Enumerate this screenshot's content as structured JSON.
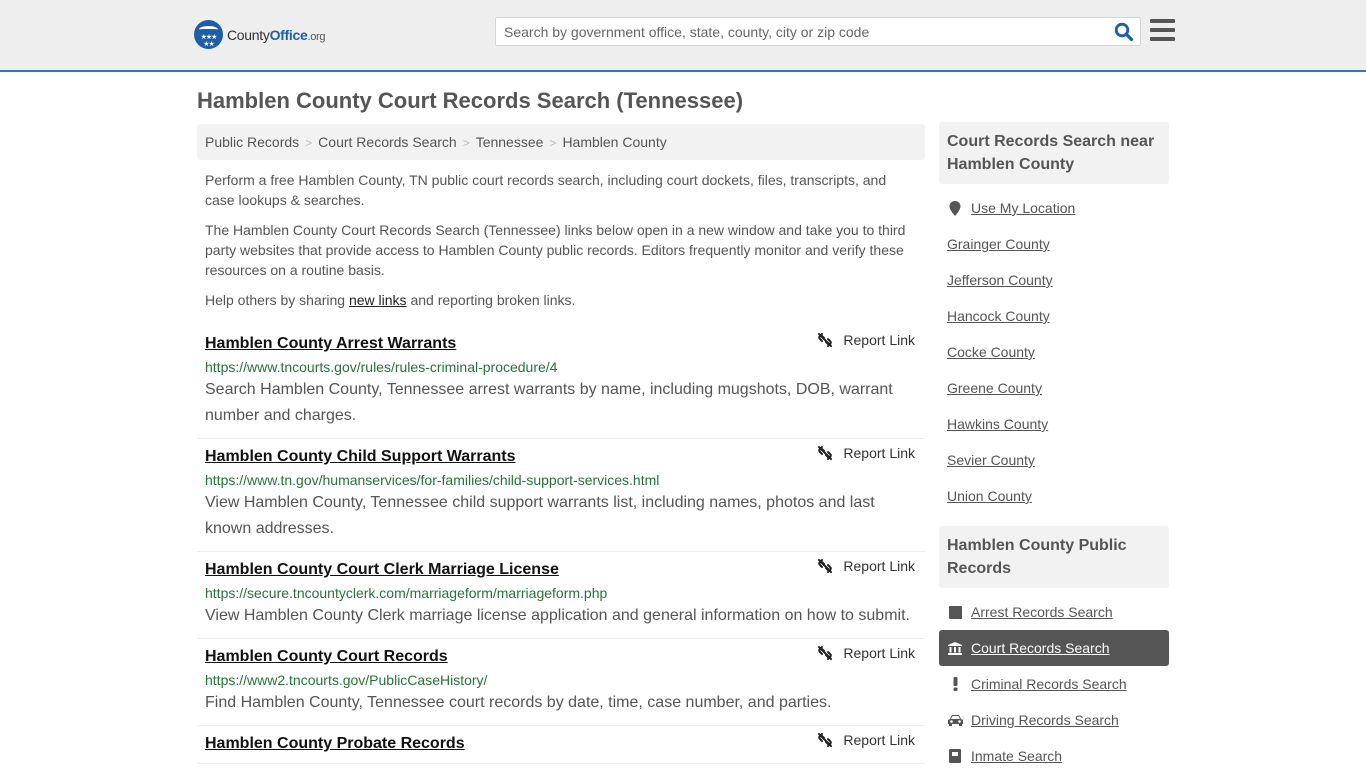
{
  "header": {
    "logo": {
      "county": "County",
      "office": "Office",
      "org": ".org"
    },
    "search_placeholder": "Search by government office, state, county, city or zip code",
    "search_value": "",
    "brand_color": "#1d5ea8",
    "accent_color": "#2f7ab5"
  },
  "page_title": "Hamblen County Court Records Search (Tennessee)",
  "breadcrumb": [
    {
      "label": "Public Records"
    },
    {
      "label": "Court Records Search"
    },
    {
      "label": "Tennessee"
    },
    {
      "label": "Hamblen County"
    }
  ],
  "intro": {
    "p1": "Perform a free Hamblen County, TN public court records search, including court dockets, files, transcripts, and case lookups & searches.",
    "p2": "The Hamblen County Court Records Search (Tennessee) links below open in a new window and take you to third party websites that provide access to Hamblen County public records. Editors frequently monitor and verify these resources on a routine basis.",
    "p3_before": "Help others by sharing ",
    "p3_link": "new links",
    "p3_after": " and reporting broken links."
  },
  "report_label": "Report Link",
  "results": [
    {
      "title": "Hamblen County Arrest Warrants",
      "url": "https://www.tncourts.gov/rules/rules-criminal-procedure/4",
      "desc": "Search Hamblen County, Tennessee arrest warrants by name, including mugshots, DOB, warrant number and charges."
    },
    {
      "title": "Hamblen County Child Support Warrants",
      "url": "https://www.tn.gov/humanservices/for-families/child-support-services.html",
      "desc": "View Hamblen County, Tennessee child support warrants list, including names, photos and last known addresses."
    },
    {
      "title": "Hamblen County Court Clerk Marriage License",
      "url": "https://secure.tncountyclerk.com/marriageform/marriageform.php",
      "desc": "View Hamblen County Clerk marriage license application and general information on how to submit."
    },
    {
      "title": "Hamblen County Court Records",
      "url": "https://www2.tncourts.gov/PublicCaseHistory/",
      "desc": "Find Hamblen County, Tennessee court records by date, time, case number, and parties."
    },
    {
      "title": "Hamblen County Probate Records",
      "url": "",
      "desc": ""
    }
  ],
  "sidebar": {
    "nearby_heading": "Court Records Search near Hamblen County",
    "use_location": "Use My Location",
    "nearby": [
      "Grainger County",
      "Jefferson County",
      "Hancock County",
      "Cocke County",
      "Greene County",
      "Hawkins County",
      "Sevier County",
      "Union County"
    ],
    "records_heading": "Hamblen County Public Records",
    "records": [
      {
        "label": "Arrest Records Search",
        "icon": "square-icon",
        "active": false
      },
      {
        "label": "Court Records Search",
        "icon": "courthouse-icon",
        "active": true
      },
      {
        "label": "Criminal Records Search",
        "icon": "exclamation-icon",
        "active": false
      },
      {
        "label": "Driving Records Search",
        "icon": "car-icon",
        "active": false
      },
      {
        "label": "Inmate Search",
        "icon": "inmate-icon",
        "active": false
      }
    ]
  }
}
